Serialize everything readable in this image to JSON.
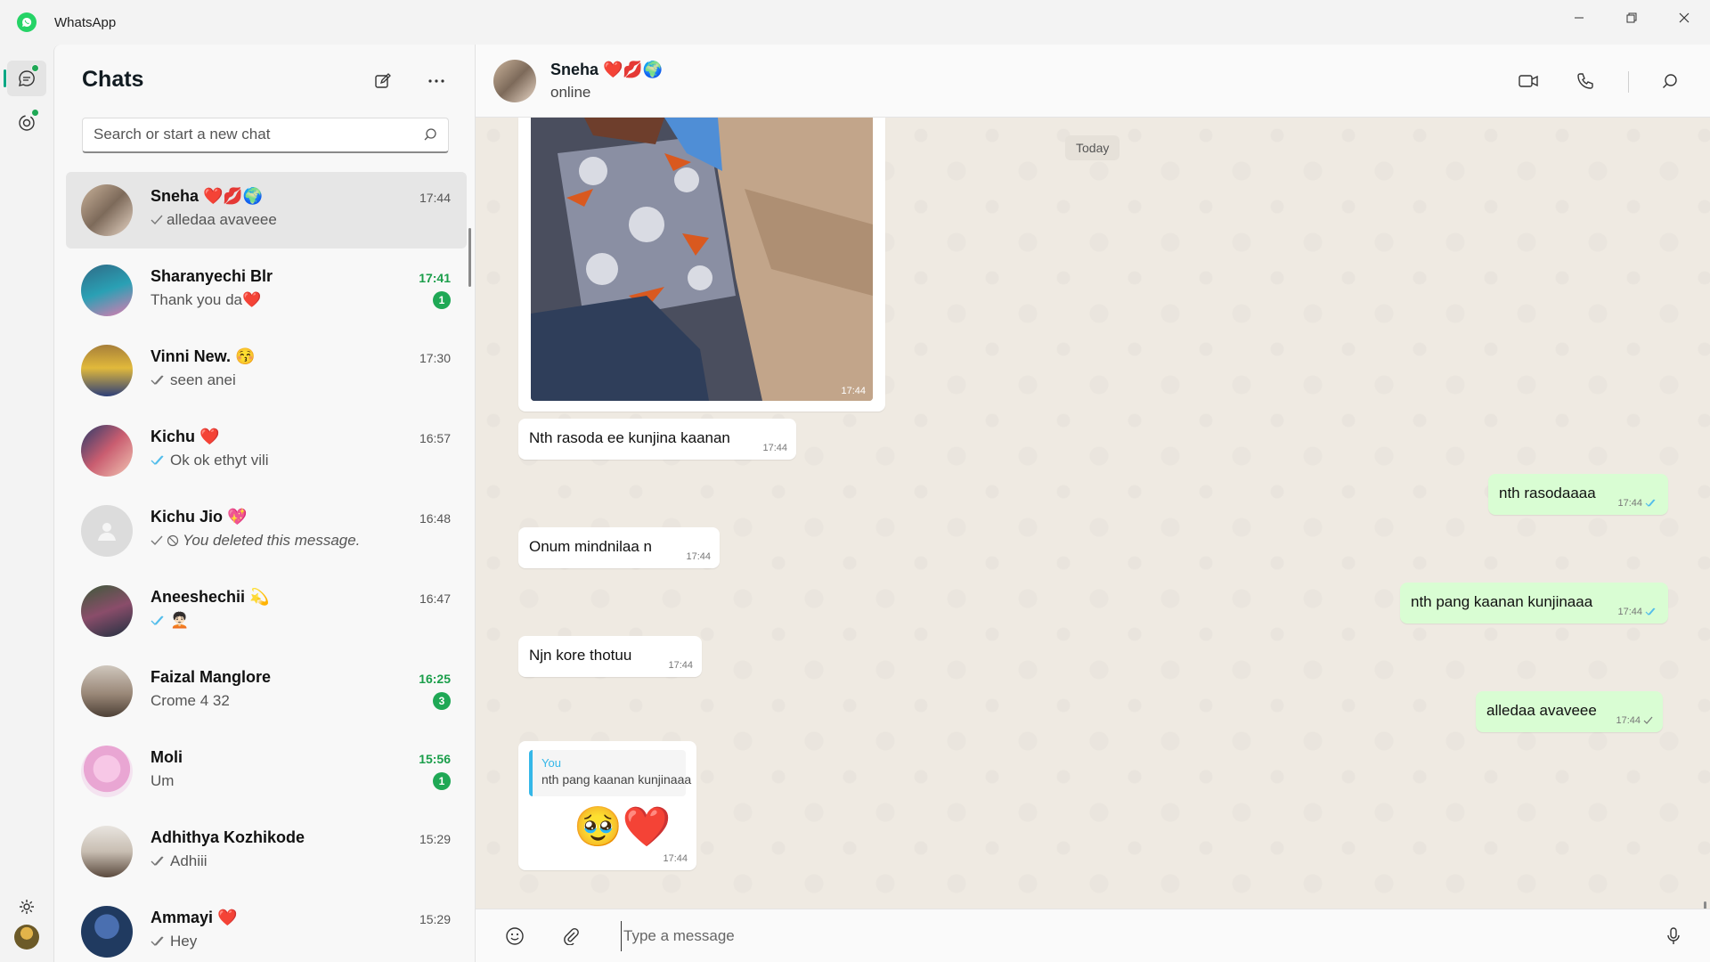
{
  "window": {
    "title": "WhatsApp",
    "controls": [
      "minimize",
      "restore",
      "close"
    ]
  },
  "rail": {
    "items": [
      {
        "name": "chats",
        "icon": "chat-bubble-icon",
        "active": true
      },
      {
        "name": "status",
        "icon": "status-ring-icon",
        "active": false
      }
    ],
    "settings_icon": "gear-icon"
  },
  "sidebar": {
    "title": "Chats",
    "search_placeholder": "Search or start a new chat",
    "chats": [
      {
        "name": "Sneha ❤️💋🌍",
        "time": "17:44",
        "preview": "alledaa avaveee",
        "ticks": "single",
        "selected": true,
        "unread": null
      },
      {
        "name": "Sharanyechi Blr",
        "time": "17:41",
        "preview": "Thank you da❤️",
        "ticks": "none",
        "selected": false,
        "unread": "1"
      },
      {
        "name": "Vinni New. 😚",
        "time": "17:30",
        "preview": "seen anei",
        "ticks": "double-grey",
        "selected": false,
        "unread": null
      },
      {
        "name": "Kichu ❤️",
        "time": "16:57",
        "preview": "Ok ok ethyt vili",
        "ticks": "double-blue",
        "selected": false,
        "unread": null
      },
      {
        "name": "Kichu Jio 💖",
        "time": "16:48",
        "preview": "You deleted this message.",
        "ticks": "single-deleted",
        "selected": false,
        "unread": null
      },
      {
        "name": "Aneeshechii 💫",
        "time": "16:47",
        "preview": "🧑🏻‍🦱",
        "ticks": "double-blue",
        "selected": false,
        "unread": null
      },
      {
        "name": "Faizal Manglore",
        "time": "16:25",
        "preview": "Crome 4 32",
        "ticks": "none",
        "selected": false,
        "unread": "3"
      },
      {
        "name": "Moli",
        "time": "15:56",
        "preview": "Um",
        "ticks": "none",
        "selected": false,
        "unread": "1"
      },
      {
        "name": "Adhithya Kozhikode",
        "time": "15:29",
        "preview": "Adhiii",
        "ticks": "double-grey",
        "selected": false,
        "unread": null
      },
      {
        "name": "Ammayi ❤️",
        "time": "15:29",
        "preview": "Hey",
        "ticks": "double-grey",
        "selected": false,
        "unread": null
      }
    ]
  },
  "conversation": {
    "name": "Sneha ❤️💋🌍",
    "status": "online",
    "date_chip": "Today",
    "image_time": "17:44",
    "messages": [
      {
        "dir": "in",
        "text": "Nth rasoda ee kunjina kaanan",
        "time": "17:44"
      },
      {
        "dir": "out",
        "text": "nth rasodaaaa",
        "time": "17:44",
        "ticks": "double-blue"
      },
      {
        "dir": "in",
        "text": "Onum mindnilaa n",
        "time": "17:44"
      },
      {
        "dir": "out",
        "text": "nth pang kaanan kunjinaaa",
        "time": "17:44",
        "ticks": "double-blue"
      },
      {
        "dir": "in",
        "text": "Njn kore thotuu",
        "time": "17:44"
      },
      {
        "dir": "out",
        "text": "alledaa avaveee",
        "time": "17:44",
        "ticks": "single"
      }
    ],
    "reply": {
      "quoted_from": "You",
      "quoted_text": "nth pang kaanan kunjinaaa",
      "content": "🥹❤️",
      "time": "17:44"
    },
    "composer_placeholder": "Type a message"
  },
  "colors": {
    "accent": "#00a884",
    "unread": "#1fa855",
    "outgoing_bubble": "#d9fdd3",
    "read_tick": "#53bdeb"
  }
}
